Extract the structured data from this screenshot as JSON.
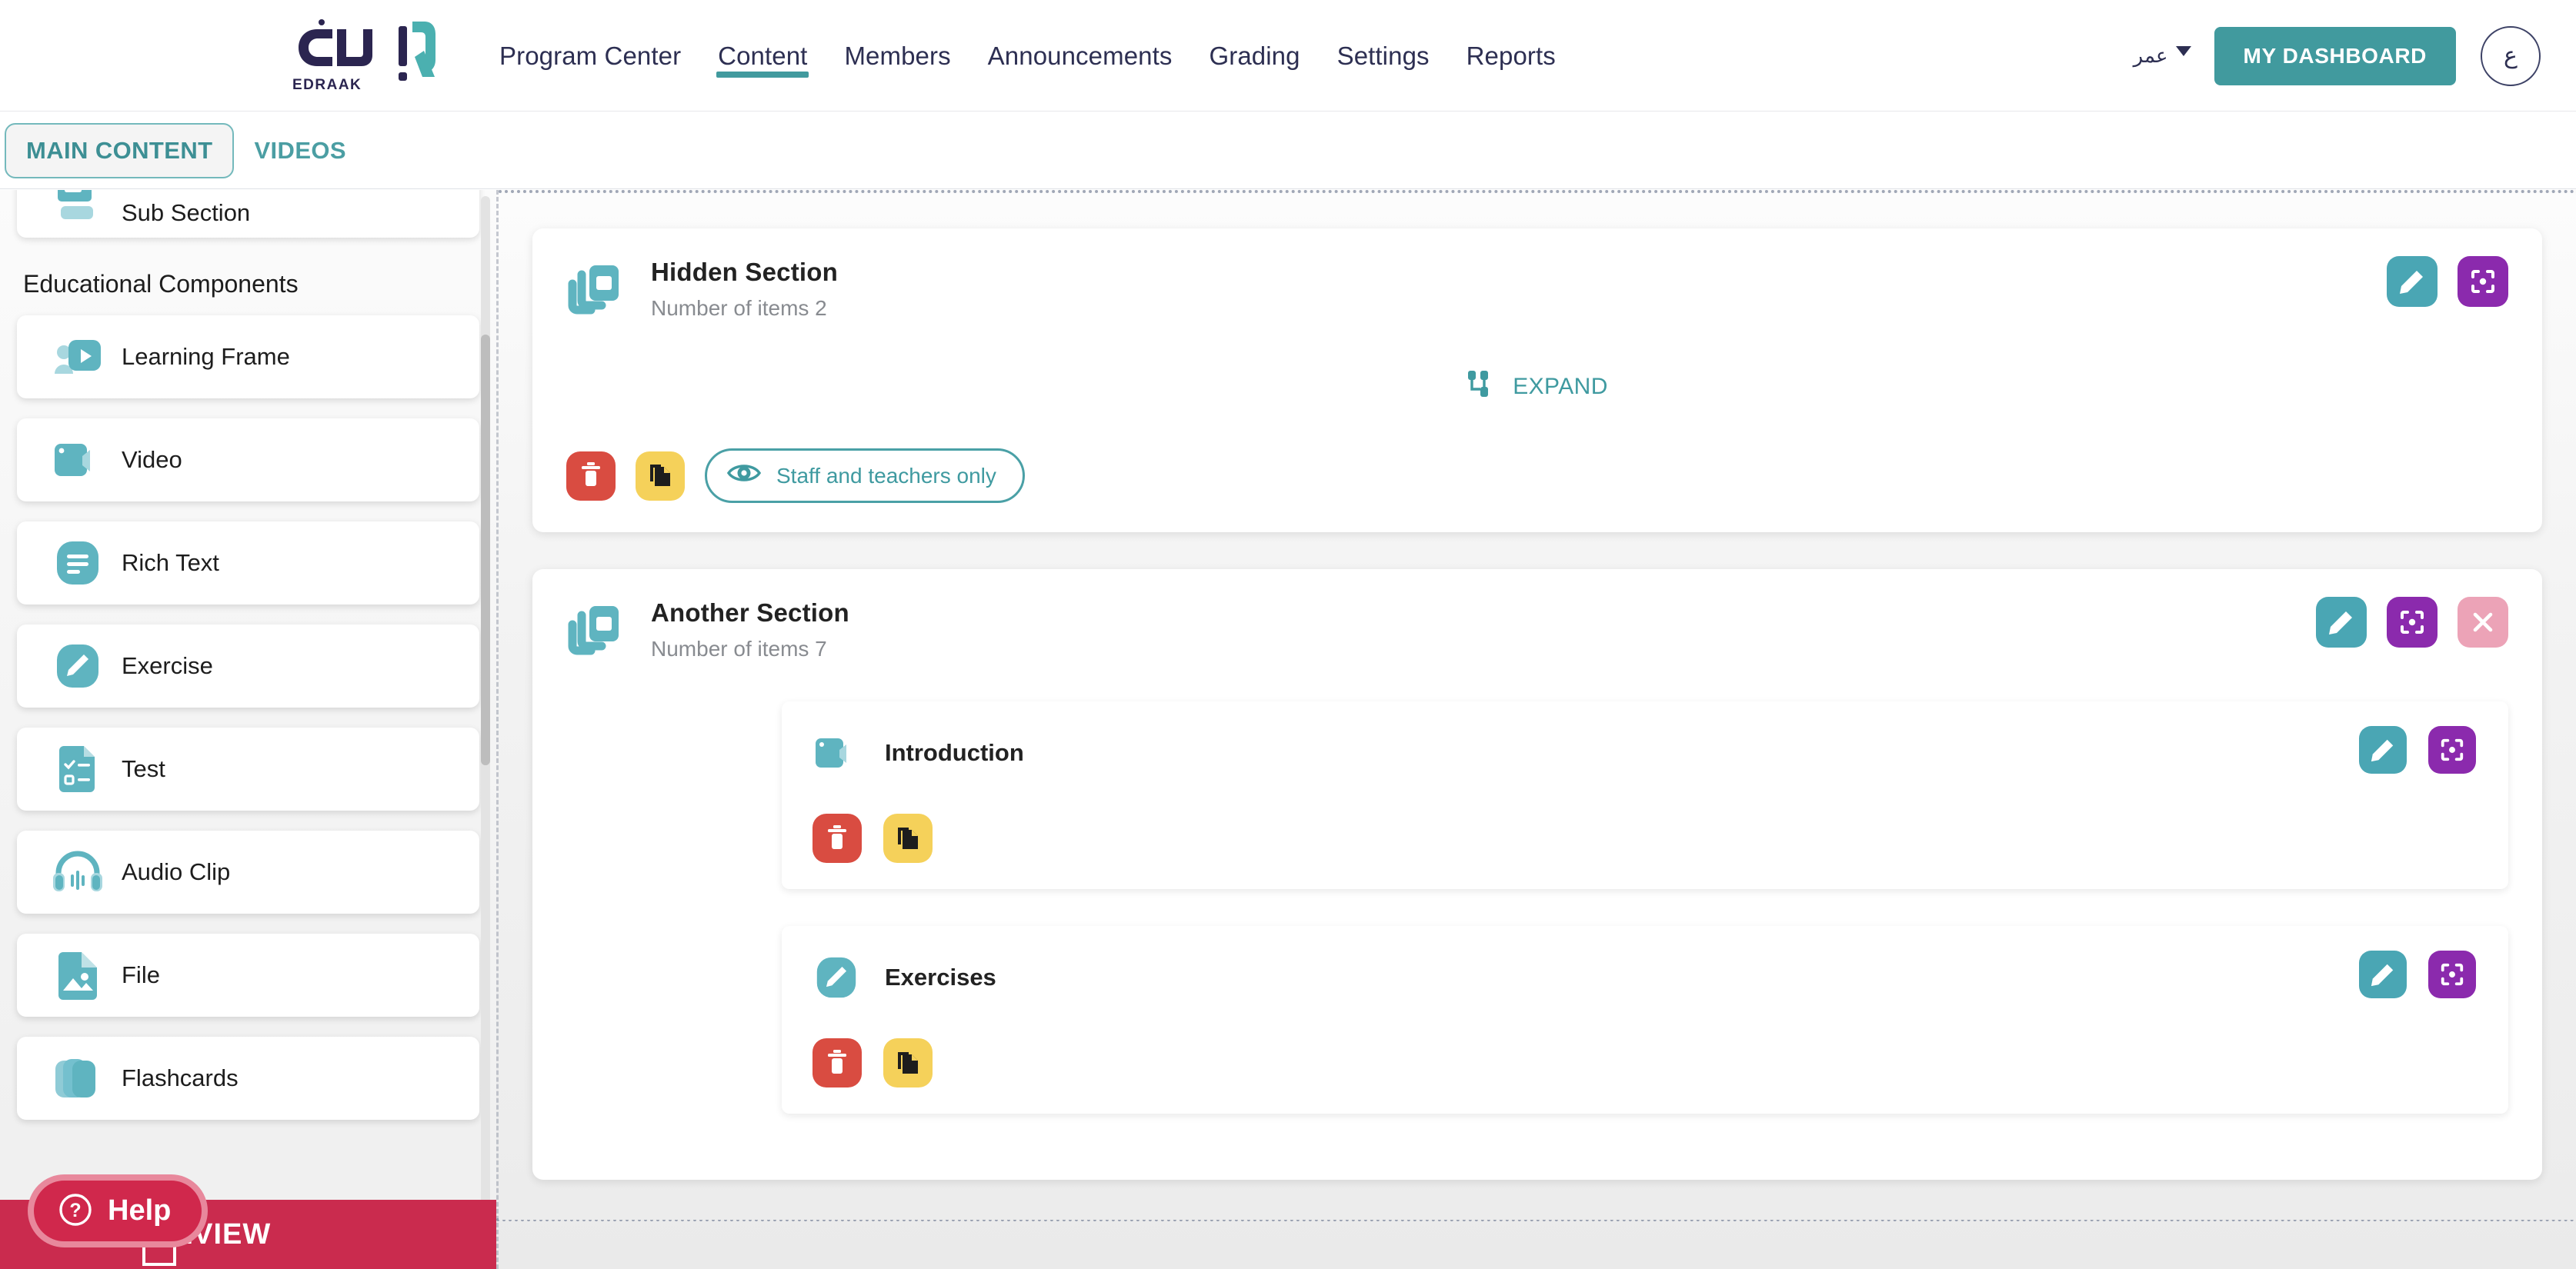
{
  "header": {
    "brand": {
      "name": "إدراك",
      "subtitle": "EDRAAK",
      "icon": "edraak-logo"
    },
    "nav": [
      {
        "label": "Program Center",
        "active": false
      },
      {
        "label": "Content",
        "active": true
      },
      {
        "label": "Members",
        "active": false
      },
      {
        "label": "Announcements",
        "active": false
      },
      {
        "label": "Grading",
        "active": false
      },
      {
        "label": "Settings",
        "active": false
      },
      {
        "label": "Reports",
        "active": false
      }
    ],
    "user_name": "عمر",
    "dashboard_button": "MY DASHBOARD",
    "avatar_initial": "ع"
  },
  "tabs": [
    {
      "label": "MAIN CONTENT",
      "active": true
    },
    {
      "label": "VIDEOS",
      "active": false
    }
  ],
  "sidebar": {
    "partial_item": {
      "label": "Sub Section",
      "icon": "sub-section-icon"
    },
    "group_title": "Educational Components",
    "items": [
      {
        "label": "Learning Frame",
        "icon": "learning-frame-icon"
      },
      {
        "label": "Video",
        "icon": "video-icon"
      },
      {
        "label": "Rich Text",
        "icon": "rich-text-icon"
      },
      {
        "label": "Exercise",
        "icon": "exercise-icon"
      },
      {
        "label": "Test",
        "icon": "test-icon"
      },
      {
        "label": "Audio Clip",
        "icon": "audio-clip-icon"
      },
      {
        "label": "File",
        "icon": "file-icon"
      },
      {
        "label": "Flashcards",
        "icon": "flashcards-icon"
      }
    ]
  },
  "main": {
    "sections": [
      {
        "title": "Hidden Section",
        "subtitle": "Number of items 2",
        "icon": "section-icon",
        "expand_label": "EXPAND",
        "expand_icon": "expand-icon",
        "visibility_label": "Staff and teachers only",
        "visibility_icon": "eye-icon",
        "delete_icon": "trash-icon",
        "duplicate_icon": "copy-icon",
        "actions": [
          {
            "name": "edit",
            "icon": "pencil-icon",
            "color": "#4aa6b4"
          },
          {
            "name": "focus",
            "icon": "focus-icon",
            "color": "#8b2aad"
          }
        ],
        "children": []
      },
      {
        "title": "Another Section",
        "subtitle": "Number of items 7",
        "icon": "section-icon",
        "actions": [
          {
            "name": "edit",
            "icon": "pencil-icon",
            "color": "#4aa6b4"
          },
          {
            "name": "focus",
            "icon": "focus-icon",
            "color": "#8b2aad"
          },
          {
            "name": "close",
            "icon": "close-icon",
            "color": "#eca3b7"
          }
        ],
        "children": [
          {
            "title": "Introduction",
            "icon": "video-icon",
            "delete_icon": "trash-icon",
            "duplicate_icon": "copy-icon",
            "actions": [
              {
                "name": "edit",
                "icon": "pencil-icon",
                "color": "#4aa6b4"
              },
              {
                "name": "focus",
                "icon": "focus-icon",
                "color": "#8b2aad"
              }
            ]
          },
          {
            "title": "Exercises",
            "icon": "exercise-icon",
            "delete_icon": "trash-icon",
            "duplicate_icon": "copy-icon",
            "actions": [
              {
                "name": "edit",
                "icon": "pencil-icon",
                "color": "#4aa6b4"
              },
              {
                "name": "focus",
                "icon": "focus-icon",
                "color": "#8b2aad"
              }
            ]
          }
        ]
      }
    ]
  },
  "footer": {
    "preview_label": "PREVIEW",
    "preview_icon": "monitor-icon",
    "help_label": "Help",
    "help_icon": "question-circle-icon"
  },
  "colors": {
    "accent_teal": "#419a9e",
    "icon_teal": "#5fb4c0",
    "purple": "#8b2aad",
    "pink": "#eca3b7",
    "red": "#d94c41",
    "yellow": "#f5d15a",
    "crimson": "#ca2b4e",
    "navy": "#2d2f52"
  }
}
